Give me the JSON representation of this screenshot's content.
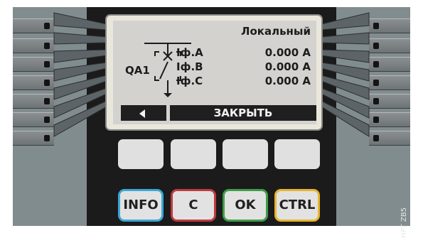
{
  "display": {
    "mode": "Локальный",
    "device": "QA1",
    "measurements": [
      {
        "label": "Iф.A",
        "value": "0.000 A"
      },
      {
        "label": "Iф.B",
        "value": "0.000 A"
      },
      {
        "label": "Iф.C",
        "value": "0.000 A"
      }
    ],
    "softkeys": {
      "right": "ЗАКРЫТЬ"
    }
  },
  "keys": {
    "info": "INFO",
    "c": "C",
    "ok": "OK",
    "ctrl": "CTRL"
  },
  "colors": {
    "info": "#3aa7d6",
    "c": "#c0393f",
    "ok": "#3f9e4a",
    "ctrl": "#e8b42b",
    "led_green": "#2fbf3a"
  },
  "watermark": "HPT ZB5"
}
